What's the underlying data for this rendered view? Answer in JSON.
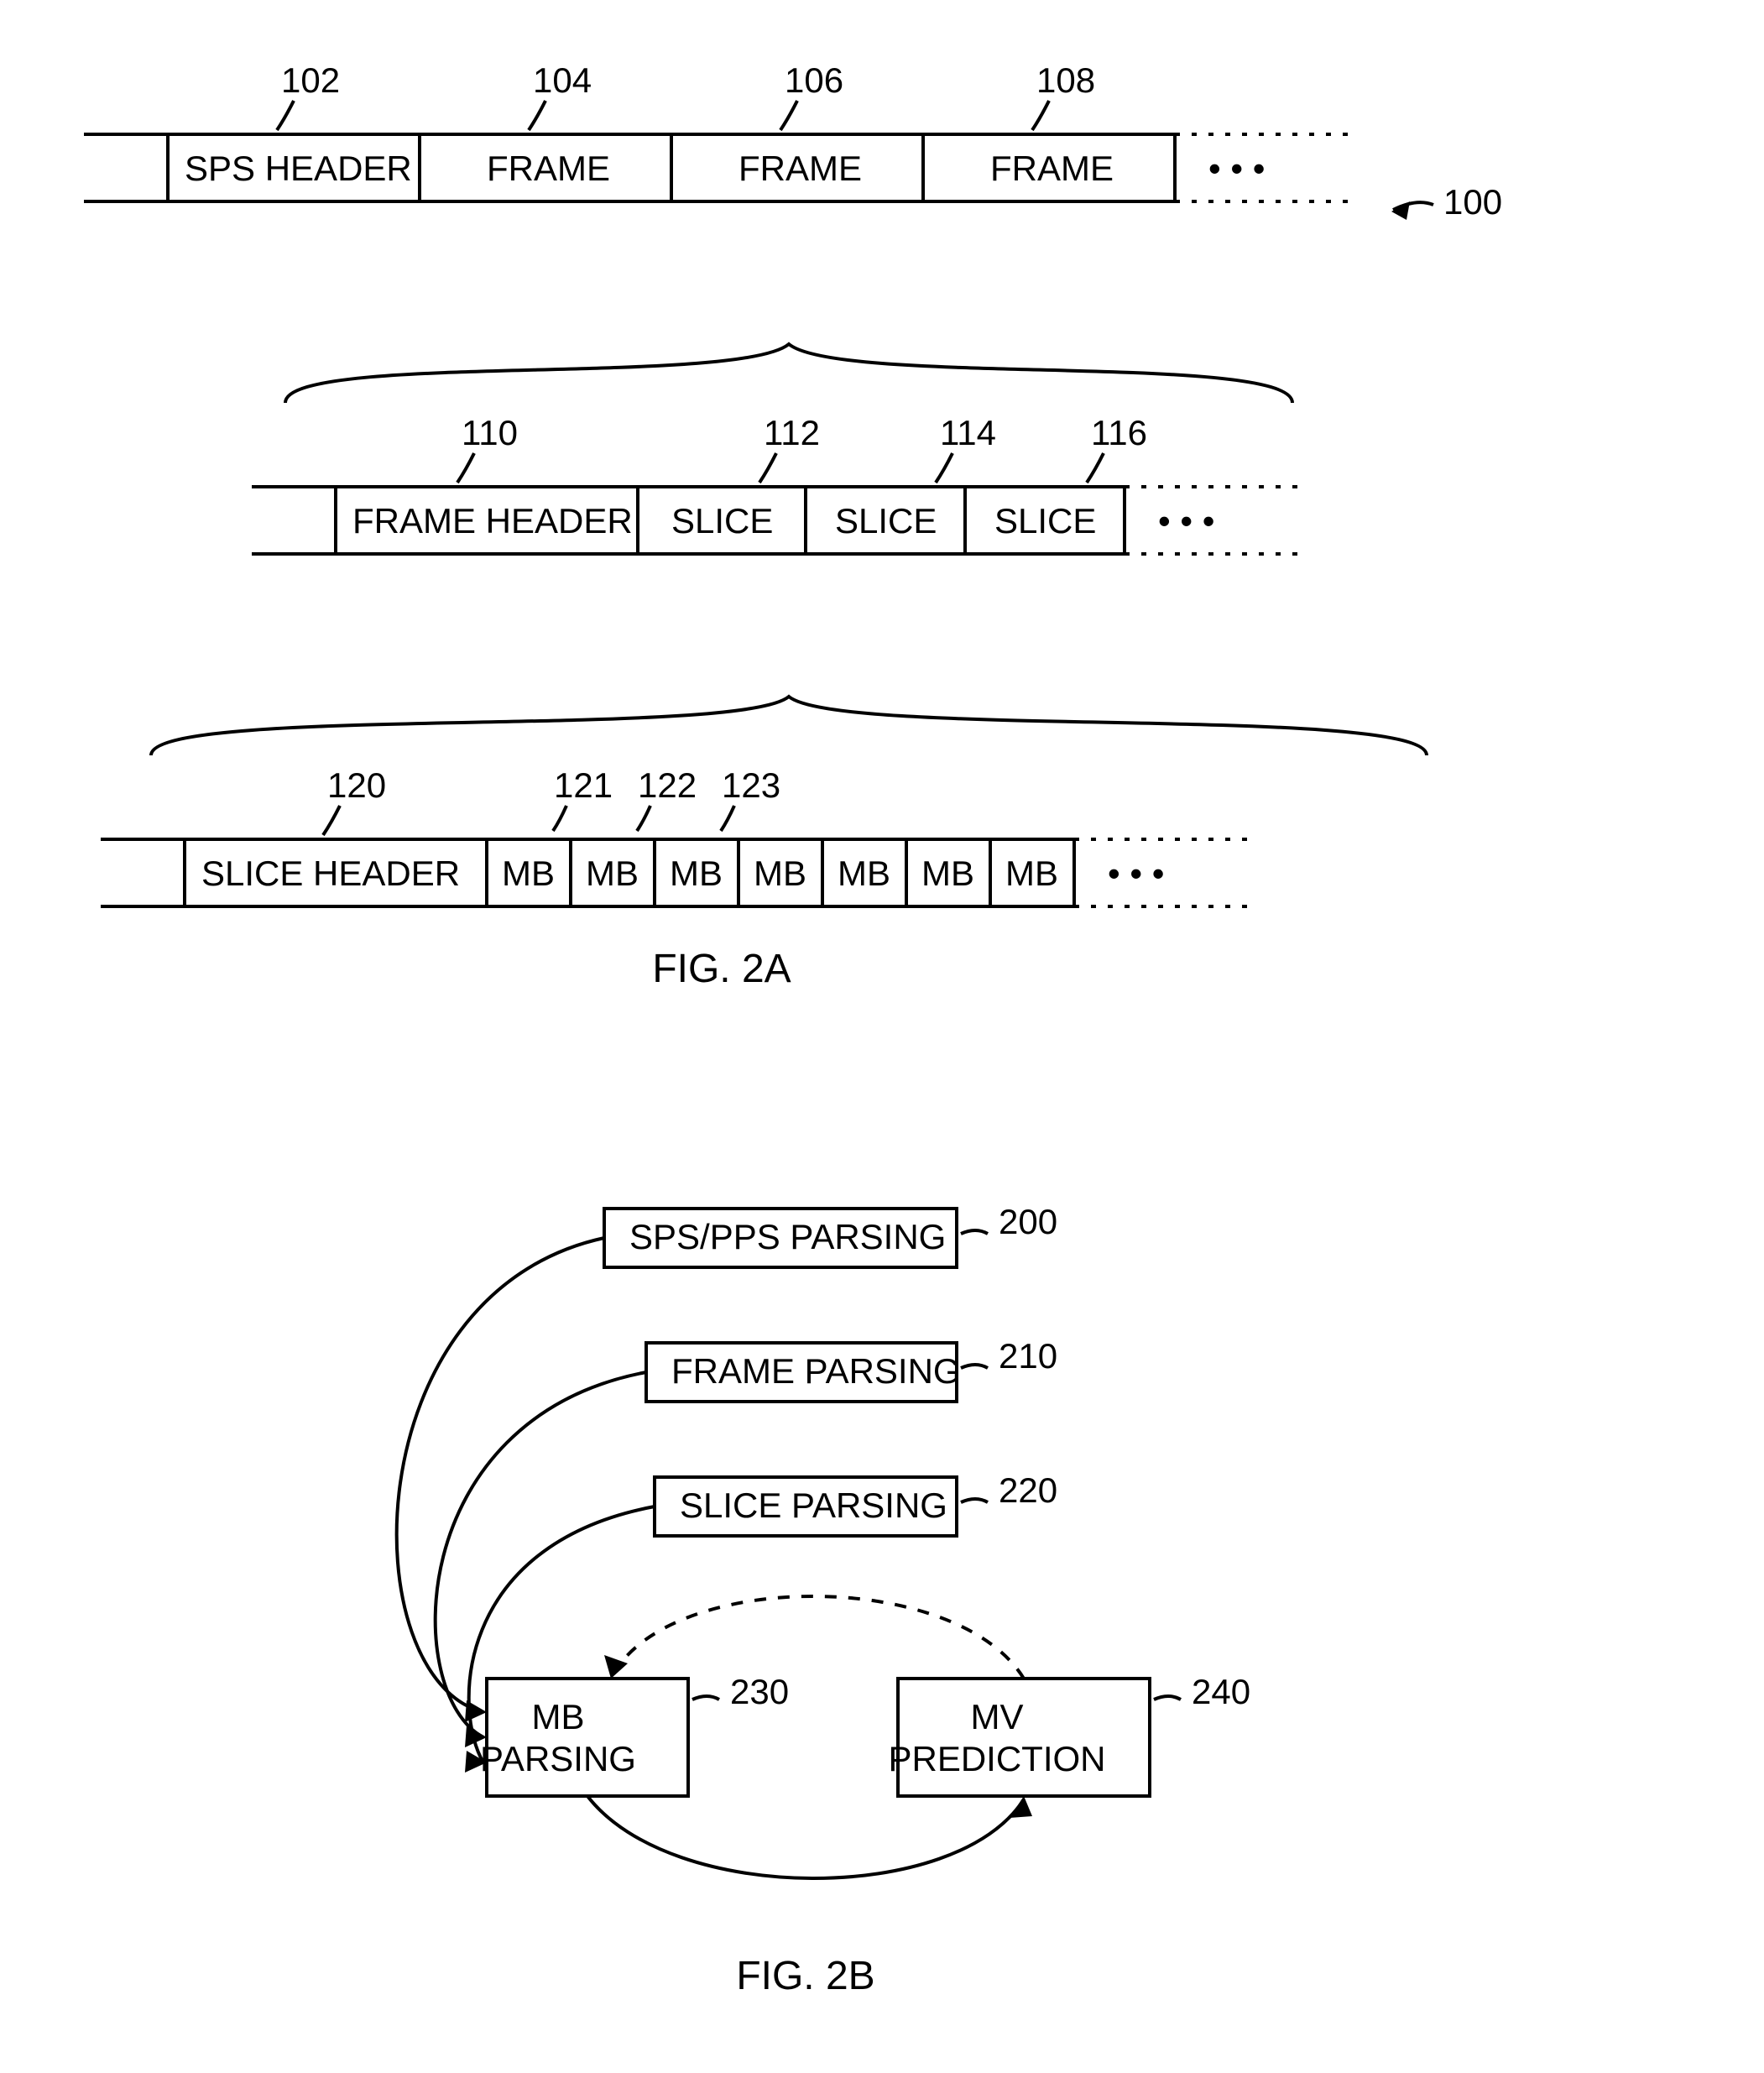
{
  "fig2a": {
    "row1": {
      "labels": {
        "n102": "102",
        "n104": "104",
        "n106": "106",
        "n108": "108",
        "n100": "100"
      },
      "cells": {
        "c1": "SPS HEADER",
        "c2": "FRAME",
        "c3": "FRAME",
        "c4": "FRAME"
      }
    },
    "row2": {
      "labels": {
        "n110": "110",
        "n112": "112",
        "n114": "114",
        "n116": "116"
      },
      "cells": {
        "c1": "FRAME HEADER",
        "c2": "SLICE",
        "c3": "SLICE",
        "c4": "SLICE"
      }
    },
    "row3": {
      "labels": {
        "n120": "120",
        "n121": "121",
        "n122": "122",
        "n123": "123"
      },
      "cells": {
        "c1": "SLICE HEADER",
        "c2": "MB",
        "c3": "MB",
        "c4": "MB",
        "c5": "MB",
        "c6": "MB",
        "c7": "MB",
        "c8": "MB"
      }
    },
    "caption": "FIG. 2A"
  },
  "fig2b": {
    "labels": {
      "n200": "200",
      "n210": "210",
      "n220": "220",
      "n230": "230",
      "n240": "240"
    },
    "blocks": {
      "b1": "SPS/PPS PARSING",
      "b2": "FRAME PARSING",
      "b3": "SLICE PARSING",
      "b4a": "MB",
      "b4b": "PARSING",
      "b5a": "MV",
      "b5b": "PREDICTION"
    },
    "caption": "FIG. 2B"
  },
  "ellipsis": "• • •"
}
